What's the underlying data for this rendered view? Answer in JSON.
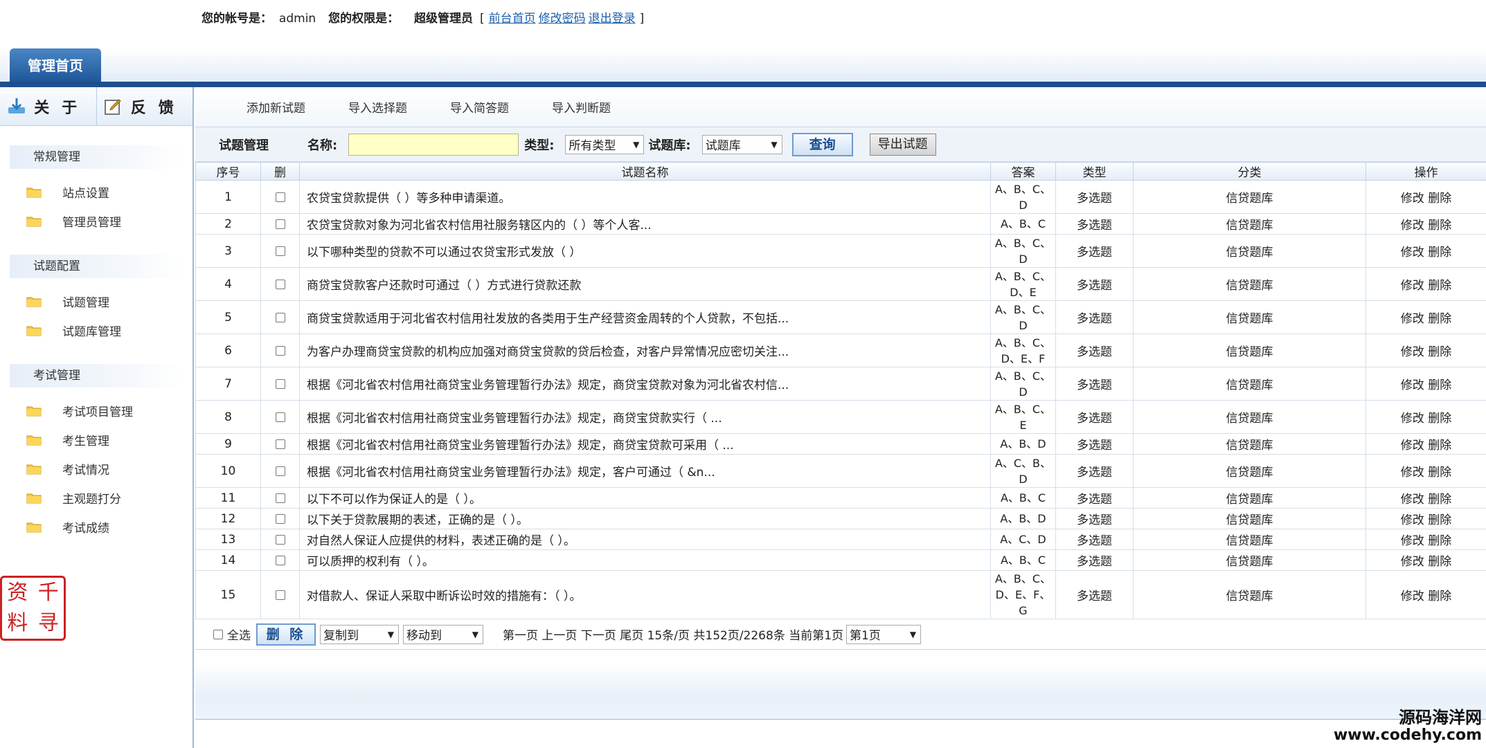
{
  "header": {
    "account_label": "您的帐号是：",
    "account": "admin",
    "permission_label": "您的权限是：",
    "permission": "超级管理员",
    "bracket_open": "[",
    "bracket_close": "]",
    "links": [
      "前台首页",
      "修改密码",
      "退出登录"
    ],
    "main_tab": "管理首页"
  },
  "sidebar": {
    "about": "关于",
    "feedback": "反馈",
    "groups": [
      {
        "title": "常规管理",
        "items": [
          "站点设置",
          "管理员管理"
        ]
      },
      {
        "title": "试题配置",
        "items": [
          "试题管理",
          "试题库管理"
        ]
      },
      {
        "title": "考试管理",
        "items": [
          "考试项目管理",
          "考生管理",
          "考试情况",
          "主观题打分",
          "考试成绩"
        ]
      }
    ],
    "stamp": [
      "千",
      "资",
      "寻",
      "料"
    ]
  },
  "topnav": [
    "添加新试题",
    "导入选择题",
    "导入简答题",
    "导入判断题"
  ],
  "search": {
    "page_title": "试题管理",
    "name_label": "名称:",
    "name_value": "",
    "type_label": "类型:",
    "type_value": "所有类型",
    "bank_label": "试题库:",
    "bank_value": "试题库",
    "query_button": "查询",
    "export_button": "导出试题"
  },
  "table": {
    "columns": [
      "序号",
      "删",
      "试题名称",
      "答案",
      "类型",
      "分类",
      "操作"
    ],
    "rows": [
      {
        "no": "1",
        "title": "农贷宝贷款提供（ ）等多种申请渠道。",
        "answer": "A、B、C、D",
        "type": "多选题",
        "category": "信贷题库"
      },
      {
        "no": "2",
        "title": "农贷宝贷款对象为河北省农村信用社服务辖区内的（ ）等个人客...",
        "answer": "A、B、C",
        "type": "多选题",
        "category": "信贷题库"
      },
      {
        "no": "3",
        "title": "以下哪种类型的贷款不可以通过农贷宝形式发放（ ）",
        "answer": "A、B、C、D",
        "type": "多选题",
        "category": "信贷题库"
      },
      {
        "no": "4",
        "title": "商贷宝贷款客户还款时可通过（ ）方式进行贷款还款",
        "answer": "A、B、C、D、E",
        "type": "多选题",
        "category": "信贷题库"
      },
      {
        "no": "5",
        "title": "商贷宝贷款适用于河北省农村信用社发放的各类用于生产经营资金周转的个人贷款，不包括...",
        "answer": "A、B、C、D",
        "type": "多选题",
        "category": "信贷题库"
      },
      {
        "no": "6",
        "title": "为客户办理商贷宝贷款的机构应加强对商贷宝贷款的贷后检查，对客户异常情况应密切关注...",
        "answer": "A、B、C、D、E、F",
        "type": "多选题",
        "category": "信贷题库"
      },
      {
        "no": "7",
        "title": "根据《河北省农村信用社商贷宝业务管理暂行办法》规定，商贷宝贷款对象为河北省农村信...",
        "answer": "A、B、C、D",
        "type": "多选题",
        "category": "信贷题库"
      },
      {
        "no": "8",
        "title": "根据《河北省农村信用社商贷宝业务管理暂行办法》规定，商贷宝贷款实行（ ...",
        "answer": "A、B、C、E",
        "type": "多选题",
        "category": "信贷题库"
      },
      {
        "no": "9",
        "title": "根据《河北省农村信用社商贷宝业务管理暂行办法》规定，商贷宝贷款可采用（ ...",
        "answer": "A、B、D",
        "type": "多选题",
        "category": "信贷题库"
      },
      {
        "no": "10",
        "title": "根据《河北省农村信用社商贷宝业务管理暂行办法》规定，客户可通过（ &n...",
        "answer": "A、C、B、D",
        "type": "多选题",
        "category": "信贷题库"
      },
      {
        "no": "11",
        "title": "以下不可以作为保证人的是（ ）。",
        "answer": "A、B、C",
        "type": "多选题",
        "category": "信贷题库"
      },
      {
        "no": "12",
        "title": "以下关于贷款展期的表述，正确的是（ ）。",
        "answer": "A、B、D",
        "type": "多选题",
        "category": "信贷题库"
      },
      {
        "no": "13",
        "title": "对自然人保证人应提供的材料，表述正确的是（ ）。",
        "answer": "A、C、D",
        "type": "多选题",
        "category": "信贷题库"
      },
      {
        "no": "14",
        "title": "可以质押的权利有（ ）。",
        "answer": "A、B、C",
        "type": "多选题",
        "category": "信贷题库"
      },
      {
        "no": "15",
        "title": "对借款人、保证人采取中断诉讼时效的措施有：（ ）。",
        "answer": "A、B、C、D、E、F、G",
        "type": "多选题",
        "category": "信贷题库"
      }
    ],
    "edit_label": "修改",
    "delete_label": "删除"
  },
  "footer": {
    "select_all": "全选",
    "delete_button": "删 除",
    "copy_to": "复制到",
    "move_to": "移动到",
    "pager_text": "第一页 上一页 下一页 尾页 15条/页 共152页/2268条 当前第1页",
    "page_select": "第1页"
  },
  "watermark": {
    "line1": "源码海洋网",
    "line2": "www.codehy.com"
  }
}
